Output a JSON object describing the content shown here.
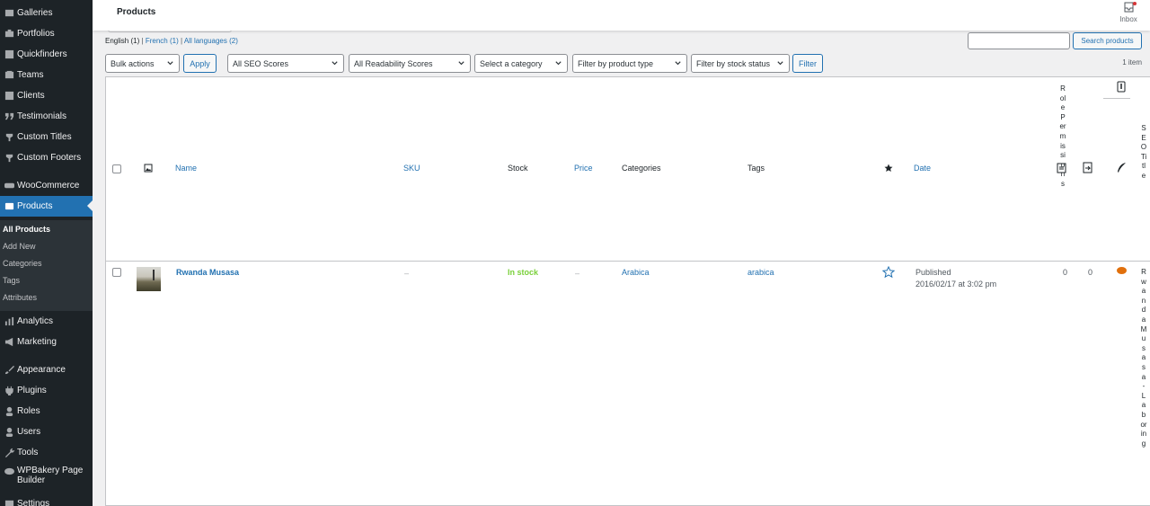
{
  "sidebar": {
    "items": [
      {
        "label": "Galleries",
        "icon": "gallery-icon"
      },
      {
        "label": "Portfolios",
        "icon": "portfolio-icon"
      },
      {
        "label": "Quickfinders",
        "icon": "quickfinder-icon"
      },
      {
        "label": "Teams",
        "icon": "team-icon"
      },
      {
        "label": "Clients",
        "icon": "clients-icon"
      },
      {
        "label": "Testimonials",
        "icon": "quote-icon"
      },
      {
        "label": "Custom Titles",
        "icon": "title-icon"
      },
      {
        "label": "Custom Footers",
        "icon": "footer-icon"
      },
      {
        "label": "WooCommerce",
        "icon": "woocommerce-icon"
      },
      {
        "label": "Products",
        "icon": "products-icon"
      },
      {
        "label": "Analytics",
        "icon": "analytics-icon"
      },
      {
        "label": "Marketing",
        "icon": "megaphone-icon"
      },
      {
        "label": "Appearance",
        "icon": "paintbrush-icon"
      },
      {
        "label": "Plugins",
        "icon": "plugin-icon"
      },
      {
        "label": "Roles",
        "icon": "roles-icon"
      },
      {
        "label": "Users",
        "icon": "users-icon"
      },
      {
        "label": "Tools",
        "icon": "wrench-icon"
      },
      {
        "label": "WPBakery Page Builder",
        "icon": "wpbakery-icon"
      },
      {
        "label": "Settings",
        "icon": "settings-icon"
      }
    ],
    "submenu": [
      "All Products",
      "Add New",
      "Categories",
      "Tags",
      "Attributes"
    ]
  },
  "topbar": {
    "title": "Products",
    "inbox_label": "Inbox"
  },
  "views": {
    "english": "English",
    "english_count": "(1)",
    "french": "French",
    "french_count": "(1)",
    "all": "All languages",
    "all_count": "(2)",
    "separator": "|"
  },
  "search": {
    "placeholder": "",
    "button": "Search products"
  },
  "filters": {
    "bulk_actions": "Bulk actions",
    "apply": "Apply",
    "seo_scores": "All SEO Scores",
    "readability": "All Readability Scores",
    "category": "Select a category",
    "product_type": "Filter by product type",
    "stock_status": "Filter by stock status",
    "filter_button": "Filter",
    "items_count": "1 item"
  },
  "columns": {
    "name": "Name",
    "sku": "SKU",
    "stock": "Stock",
    "price": "Price",
    "categories": "Categories",
    "tags": "Tags",
    "date": "Date",
    "role_permissions": "Role Permissions",
    "seo_title": "SEO Title"
  },
  "rows": [
    {
      "name": "Rwanda Musasa",
      "sku": "–",
      "stock": "In stock",
      "price": "–",
      "categories": "Arabica",
      "tags": "arabica",
      "status": "Published",
      "date": "2016/02/17 at 3:02 pm",
      "count_a": "0",
      "count_b": "0",
      "seo_title": "Rwanda Musasa - Laboring"
    }
  ],
  "colors": {
    "sidebar_bg": "#1d2327",
    "accent": "#2271b1",
    "in_stock": "#7ad03a",
    "seo_dot": "#e1700c"
  }
}
